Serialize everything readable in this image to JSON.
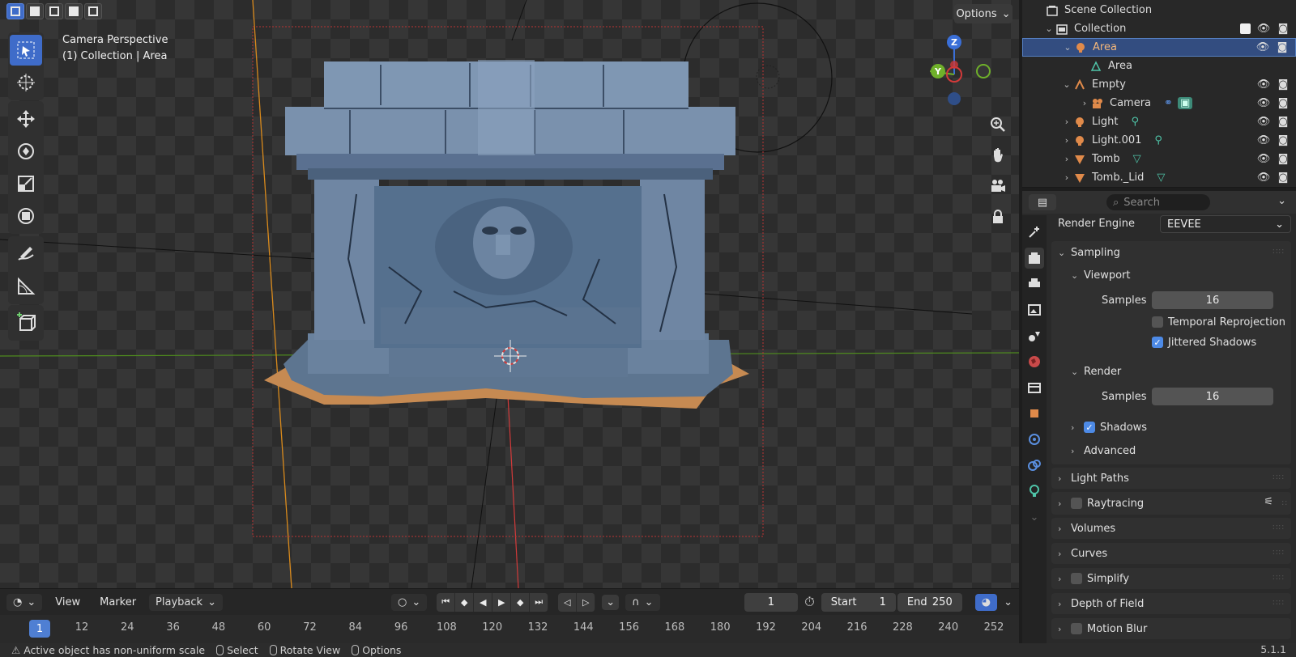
{
  "viewport": {
    "options_label": "Options",
    "camera_label": "Camera Perspective",
    "collection_label": "(1) Collection | Area",
    "gizmo": {
      "z": "Z",
      "y": "Y"
    }
  },
  "outliner": {
    "title": "Scene Collection",
    "rows": [
      {
        "label": "Collection"
      },
      {
        "label": "Area"
      },
      {
        "label": "Area"
      },
      {
        "label": "Empty"
      },
      {
        "label": "Camera"
      },
      {
        "label": "Light"
      },
      {
        "label": "Light.001"
      },
      {
        "label": "Tomb"
      },
      {
        "label": "Tomb._Lid"
      }
    ]
  },
  "properties": {
    "search_placeholder": "Search",
    "render_engine_label": "Render Engine",
    "render_engine_value": "EEVEE",
    "sampling": {
      "title": "Sampling",
      "viewport_title": "Viewport",
      "viewport_samples_label": "Samples",
      "viewport_samples": "16",
      "temporal_reprojection": "Temporal Reprojection",
      "jittered_shadows": "Jittered Shadows",
      "render_title": "Render",
      "render_samples_label": "Samples",
      "render_samples": "16",
      "shadows": "Shadows",
      "advanced": "Advanced"
    },
    "panels": {
      "light_paths": "Light Paths",
      "raytracing": "Raytracing",
      "volumes": "Volumes",
      "curves": "Curves",
      "simplify": "Simplify",
      "depth_of_field": "Depth of Field",
      "motion_blur": "Motion Blur"
    }
  },
  "timeline": {
    "menus": {
      "view": "View",
      "marker": "Marker",
      "playback": "Playback"
    },
    "current_frame": "1",
    "start_label": "Start",
    "start_value": "1",
    "end_label": "End",
    "end_value": "250",
    "ruler_current": "1",
    "ruler_ticks": [
      "12",
      "24",
      "36",
      "48",
      "60",
      "72",
      "84",
      "96",
      "108",
      "120",
      "132",
      "144",
      "156",
      "168",
      "180",
      "192",
      "204",
      "216",
      "228",
      "240",
      "252"
    ]
  },
  "statusbar": {
    "warning": "Active object has non-uniform scale",
    "select": "Select",
    "rotate": "Rotate View",
    "options": "Options",
    "version": "5.1.1"
  },
  "colors": {
    "accent": "#3f6cc9",
    "selected_label": "#f4b77a",
    "stone": "#6f86a3",
    "sand": "#c68a52",
    "x_axis": "#d23a3a",
    "y_axis": "#6fb02a",
    "z_axis": "#3a6fd8"
  }
}
